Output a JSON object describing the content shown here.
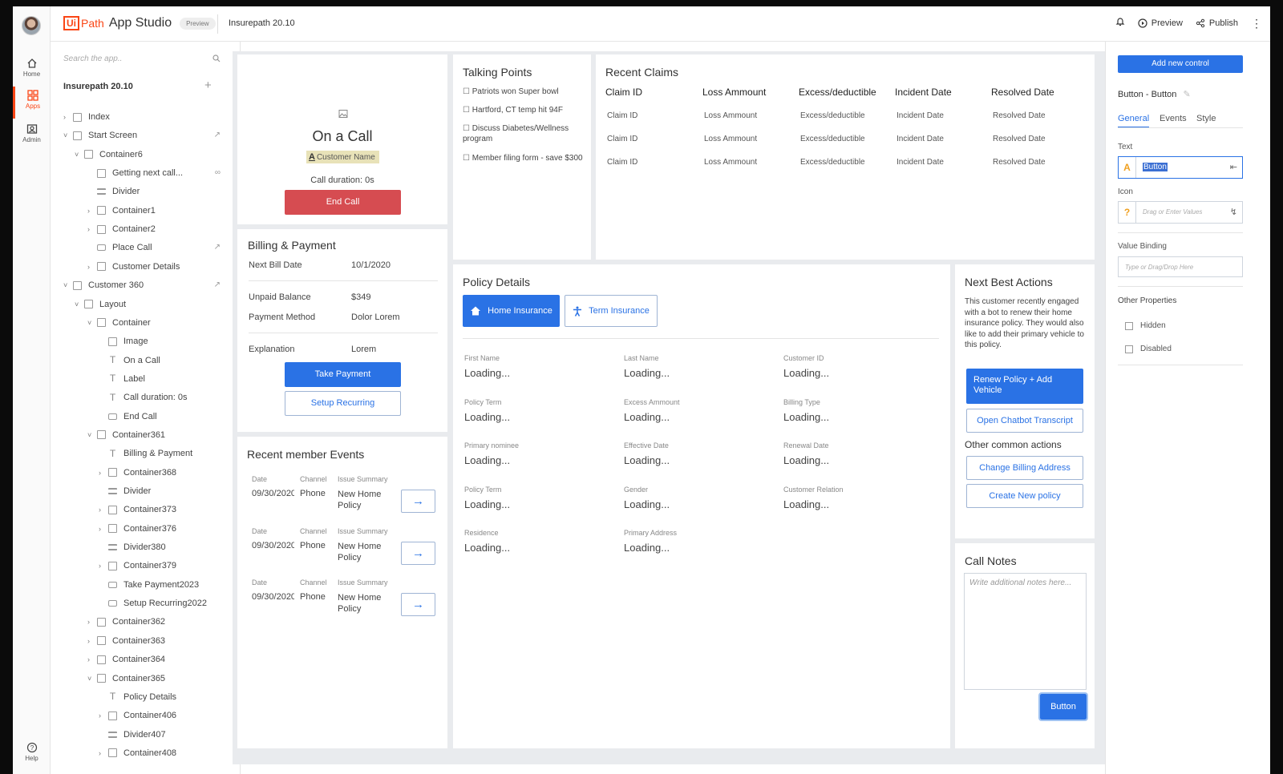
{
  "rail": {
    "items": [
      {
        "label": "Home"
      },
      {
        "label": "Apps"
      },
      {
        "label": "Admin"
      },
      {
        "label": "Help"
      }
    ]
  },
  "topbar": {
    "brand_ui": "Ui",
    "brand_path": "Path",
    "brand_title": "App Studio",
    "badge": "Preview",
    "project": "Insurepath 20.10",
    "preview_label": "Preview",
    "publish_label": "Publish"
  },
  "tree": {
    "search_placeholder": "Search the app..",
    "project": "Insurepath 20.10",
    "rows": [
      {
        "label": "Index"
      },
      {
        "label": "Start Screen"
      },
      {
        "label": "Container6"
      },
      {
        "label": "Getting next call..."
      },
      {
        "label": "Divider"
      },
      {
        "label": "Container1"
      },
      {
        "label": "Container2"
      },
      {
        "label": "Place Call"
      },
      {
        "label": "Customer Details"
      },
      {
        "label": "Customer 360"
      },
      {
        "label": "Layout"
      },
      {
        "label": "Container"
      },
      {
        "label": "Image"
      },
      {
        "label": "On a Call"
      },
      {
        "label": "Label"
      },
      {
        "label": "Call duration: 0s"
      },
      {
        "label": "End Call"
      },
      {
        "label": "Container361"
      },
      {
        "label": "Billing & Payment"
      },
      {
        "label": "Container368"
      },
      {
        "label": "Divider"
      },
      {
        "label": "Container373"
      },
      {
        "label": "Container376"
      },
      {
        "label": "Divider380"
      },
      {
        "label": "Container379"
      },
      {
        "label": "Take Payment2023"
      },
      {
        "label": "Setup Recurring2022"
      },
      {
        "label": "Container362"
      },
      {
        "label": "Container363"
      },
      {
        "label": "Container364"
      },
      {
        "label": "Container365"
      },
      {
        "label": "Policy Details"
      },
      {
        "label": "Container406"
      },
      {
        "label": "Divider407"
      },
      {
        "label": "Container408"
      }
    ]
  },
  "call": {
    "title": "On a Call",
    "customer": "Customer Name",
    "duration": "Call duration: 0s",
    "end_call": "End Call"
  },
  "billing": {
    "title": "Billing & Payment",
    "rows": [
      {
        "label": "Next Bill Date",
        "value": "10/1/2020"
      },
      {
        "label": "Unpaid Balance",
        "value": "$349"
      },
      {
        "label": "Payment Method",
        "value": "Dolor Lorem"
      },
      {
        "label": "Explanation",
        "value": "Lorem"
      }
    ],
    "take_payment": "Take Payment",
    "setup_recurring": "Setup Recurring"
  },
  "events": {
    "title": "Recent member Events",
    "headers": {
      "date": "Date",
      "channel": "Channel",
      "summary": "Issue Summary"
    },
    "items": [
      {
        "date": "09/30/2020",
        "channel": "Phone",
        "summary": "New Home Policy"
      },
      {
        "date": "09/30/2020",
        "channel": "Phone",
        "summary": "New Home Policy"
      },
      {
        "date": "09/30/2020",
        "channel": "Phone",
        "summary": "New Home Policy"
      }
    ]
  },
  "talking": {
    "title": "Talking Points",
    "items": [
      "Patriots won Super bowl",
      "Hartford, CT temp hit 94F",
      "Discuss Diabetes/Wellness program",
      "Member filing form - save $300"
    ]
  },
  "claims": {
    "title": "Recent Claims",
    "headers": [
      "Claim ID",
      "Loss Ammount",
      "Excess/deductible",
      "Incident Date",
      "Resolved Date"
    ],
    "rows": [
      [
        "Claim ID",
        "Loss Ammount",
        "Excess/deductible",
        "Incident Date",
        "Resolved Date"
      ],
      [
        "Claim ID",
        "Loss Ammount",
        "Excess/deductible",
        "Incident Date",
        "Resolved Date"
      ],
      [
        "Claim ID",
        "Loss Ammount",
        "Excess/deductible",
        "Incident Date",
        "Resolved Date"
      ]
    ]
  },
  "policy": {
    "title": "Policy Details",
    "tab_home": "Home Insurance",
    "tab_term": "Term Insurance",
    "fields": [
      {
        "label": "First Name",
        "value": "Loading..."
      },
      {
        "label": "Last Name",
        "value": "Loading..."
      },
      {
        "label": "Customer ID",
        "value": "Loading..."
      },
      {
        "label": "Policy Term",
        "value": "Loading..."
      },
      {
        "label": "Excess Ammount",
        "value": "Loading..."
      },
      {
        "label": "Billing Type",
        "value": "Loading..."
      },
      {
        "label": "Primary nominee",
        "value": "Loading..."
      },
      {
        "label": "Effective Date",
        "value": "Loading..."
      },
      {
        "label": "Renewal Date",
        "value": "Loading..."
      },
      {
        "label": "Policy Term",
        "value": "Loading..."
      },
      {
        "label": "Gender",
        "value": "Loading..."
      },
      {
        "label": "Customer Relation",
        "value": "Loading..."
      },
      {
        "label": "Residence",
        "value": "Loading..."
      },
      {
        "label": "Primary Address",
        "value": "Loading..."
      }
    ]
  },
  "nba": {
    "title": "Next Best Actions",
    "description": "This customer recently engaged with a bot to renew their home insurance policy. They would also like to add their primary vehicle to this policy.",
    "renew": "Renew Policy + Add Vehicle",
    "chatbot": "Open Chatbot Transcript",
    "other_title": "Other common actions",
    "change_billing": "Change Billing Address",
    "create_policy": "Create New policy"
  },
  "notes": {
    "title": "Call Notes",
    "placeholder": "Write additional notes here...",
    "button": "Button"
  },
  "props": {
    "add_control": "Add new control",
    "selected": "Button - Button",
    "tabs": [
      "General",
      "Events",
      "Style"
    ],
    "text_label": "Text",
    "text_value": "Button",
    "icon_label": "Icon",
    "icon_placeholder": "Drag or Enter Values",
    "binding_label": "Value Binding",
    "binding_placeholder": "Type or Drag/Drop Here",
    "other_label": "Other Properties",
    "hidden": "Hidden",
    "disabled": "Disabled"
  },
  "colors": {
    "brand": "#fa4616",
    "primary": "#2a72e5",
    "danger": "#d64c51",
    "canvas_bg": "#e9ebee"
  }
}
